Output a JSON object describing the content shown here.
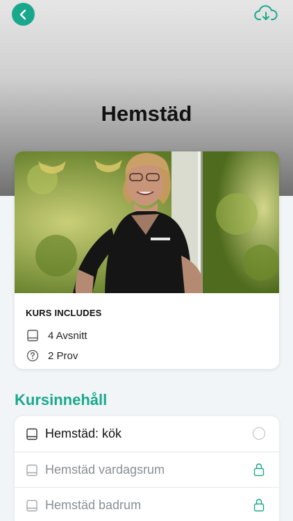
{
  "header": {
    "title": "Hemstäd",
    "back_icon": "chevron-left-icon",
    "download_icon": "cloud-download-icon"
  },
  "course_card": {
    "image": "woman-portrait-photo",
    "includes_title": "KURS INCLUDES",
    "includes": [
      {
        "icon": "book-icon",
        "label": "4 Avsnitt"
      },
      {
        "icon": "question-circle-icon",
        "label": "2 Prov"
      }
    ]
  },
  "content": {
    "section_title": "Kursinnehåll",
    "items": [
      {
        "label": "Hemstäd: kök",
        "state": "open",
        "status_icon": "empty-circle-icon"
      },
      {
        "label": "Hemstäd vardagsrum",
        "state": "locked",
        "status_icon": "lock-icon"
      },
      {
        "label": "Hemstäd badrum",
        "state": "locked",
        "status_icon": "lock-icon"
      }
    ]
  },
  "colors": {
    "accent": "#1aa88c",
    "text_primary": "#111111",
    "text_disabled": "#8a8f93"
  }
}
